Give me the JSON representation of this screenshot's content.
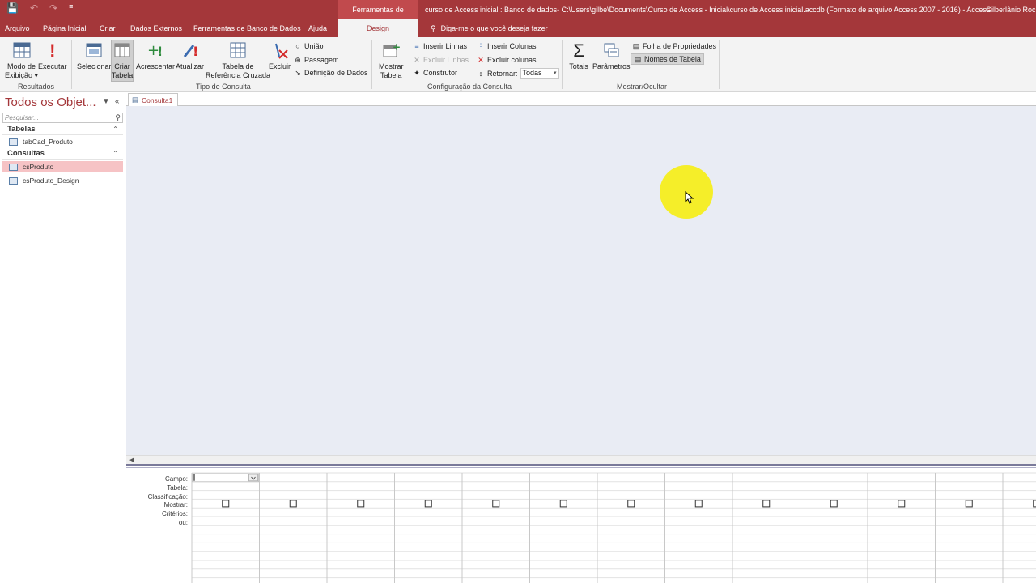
{
  "titlebar": {
    "context_tab_group": "Ferramentas de Consulta",
    "document_title": "curso de Access inicial : Banco de dados- C:\\Users\\gilbe\\Documents\\Curso de Access - Inicial\\curso de Access inicial.accdb (Formato de arquivo Access 2007 - 2016)  -  Access",
    "user": "Gilberlânio Roch"
  },
  "tabs": [
    "Arquivo",
    "Página Inicial",
    "Criar",
    "Dados Externos",
    "Ferramentas de Banco de Dados",
    "Ajuda"
  ],
  "active_tab": "Design",
  "tell_me": "Diga-me o que você deseja fazer",
  "ribbon": {
    "resultados": {
      "group_label": "Resultados",
      "view_label1": "Modo de",
      "view_label2": "Exibição ▾",
      "run_label": "Executar"
    },
    "tipo": {
      "group_label": "Tipo de Consulta",
      "select": "Selecionar",
      "make_table1": "Criar",
      "make_table2": "Tabela",
      "append": "Acrescentar",
      "update": "Atualizar",
      "crosstab1": "Tabela de",
      "crosstab2": "Referência Cruzada",
      "delete": "Excluir",
      "union": "União",
      "passthrough": "Passagem",
      "datadef": "Definição de Dados"
    },
    "config": {
      "group_label": "Configuração da Consulta",
      "show_table1": "Mostrar",
      "show_table2": "Tabela",
      "insert_rows": "Inserir Linhas",
      "delete_rows": "Excluir Linhas",
      "builder": "Construtor",
      "insert_cols": "Inserir Colunas",
      "delete_cols": "Excluir colunas",
      "return_label": "Retornar:",
      "return_value": "Todas"
    },
    "mostrar": {
      "group_label": "Mostrar/Ocultar",
      "totals": "Totais",
      "params": "Parâmetros",
      "prop_sheet": "Folha de Propriedades",
      "table_names": "Nomes de Tabela"
    }
  },
  "nav": {
    "header": "Todos os Objet...",
    "search_placeholder": "Pesquisar...",
    "sections": [
      {
        "label": "Tabelas",
        "items": [
          "tabCad_Produto"
        ]
      },
      {
        "label": "Consultas",
        "items": [
          "csProduto",
          "csProduto_Design"
        ]
      }
    ]
  },
  "document_tab": "Consulta1",
  "grid": {
    "row_labels": [
      "Campo:",
      "Tabela:",
      "Classificação:",
      "Mostrar:",
      "Critérios:",
      "ou:"
    ],
    "columns": 13
  }
}
